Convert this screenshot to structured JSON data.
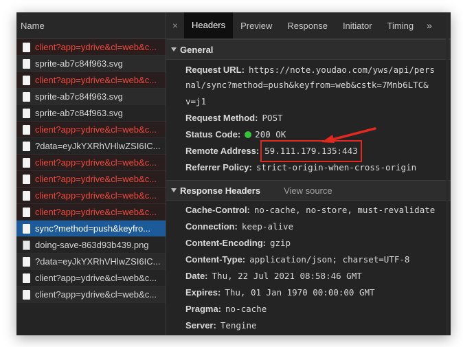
{
  "requests": [
    {
      "name": "client?app=ydrive&cl=web&c...",
      "status": "error"
    },
    {
      "name": "sprite-ab7c84f963.svg",
      "status": "ok"
    },
    {
      "name": "client?app=ydrive&cl=web&c...",
      "status": "error"
    },
    {
      "name": "sprite-ab7c84f963.svg",
      "status": "ok"
    },
    {
      "name": "sprite-ab7c84f963.svg",
      "status": "ok"
    },
    {
      "name": "client?app=ydrive&cl=web&c...",
      "status": "error"
    },
    {
      "name": "?data=eyJkYXRhVHlwZSI6IC...",
      "status": "ok"
    },
    {
      "name": "client?app=ydrive&cl=web&c...",
      "status": "error"
    },
    {
      "name": "client?app=ydrive&cl=web&c...",
      "status": "error"
    },
    {
      "name": "client?app=ydrive&cl=web&c...",
      "status": "error"
    },
    {
      "name": "client?app=ydrive&cl=web&c...",
      "status": "error"
    },
    {
      "name": "sync?method=push&keyfro...",
      "status": "selected"
    },
    {
      "name": "doing-save-863d93b439.png",
      "status": "ok"
    },
    {
      "name": "?data=eyJkYXRhVHlwZSI6IC...",
      "status": "ok"
    },
    {
      "name": "client?app=ydrive&cl=web&c...",
      "status": "ok"
    },
    {
      "name": "client?app=ydrive&cl=web&c...",
      "status": "ok"
    }
  ],
  "left_header": "Name",
  "tabs": {
    "close": "×",
    "items": [
      "Headers",
      "Preview",
      "Response",
      "Initiator",
      "Timing"
    ],
    "more": "»"
  },
  "general": {
    "title": "General",
    "request_url_key": "Request URL:",
    "request_url_lines": [
      "https://note.youdao.com/yws/api/pers",
      "nal/sync?method=push&keyfrom=web&cstk=7Mnb6LTC&",
      "v=j1"
    ],
    "request_method_key": "Request Method:",
    "request_method": "POST",
    "status_code_key": "Status Code:",
    "status_code": "200 OK",
    "status_color": "#35c33a",
    "remote_address_key": "Remote Address:",
    "remote_address": "59.111.179.135:443",
    "referrer_policy_key": "Referrer Policy:",
    "referrer_policy": "strict-origin-when-cross-origin"
  },
  "response_headers": {
    "title": "Response Headers",
    "view_source": "View source",
    "items": [
      {
        "key": "Cache-Control:",
        "value": "no-cache, no-store, must-revalidate"
      },
      {
        "key": "Connection:",
        "value": "keep-alive"
      },
      {
        "key": "Content-Encoding:",
        "value": "gzip"
      },
      {
        "key": "Content-Type:",
        "value": "application/json; charset=UTF-8"
      },
      {
        "key": "Date:",
        "value": "Thu, 22 Jul 2021 08:58:46 GMT"
      },
      {
        "key": "Expires:",
        "value": "Thu, 01 Jan 1970 00:00:00 GMT"
      },
      {
        "key": "Pragma:",
        "value": "no-cache"
      },
      {
        "key": "Server:",
        "value": "Tengine"
      }
    ]
  },
  "annotation_color": "#e0291f"
}
